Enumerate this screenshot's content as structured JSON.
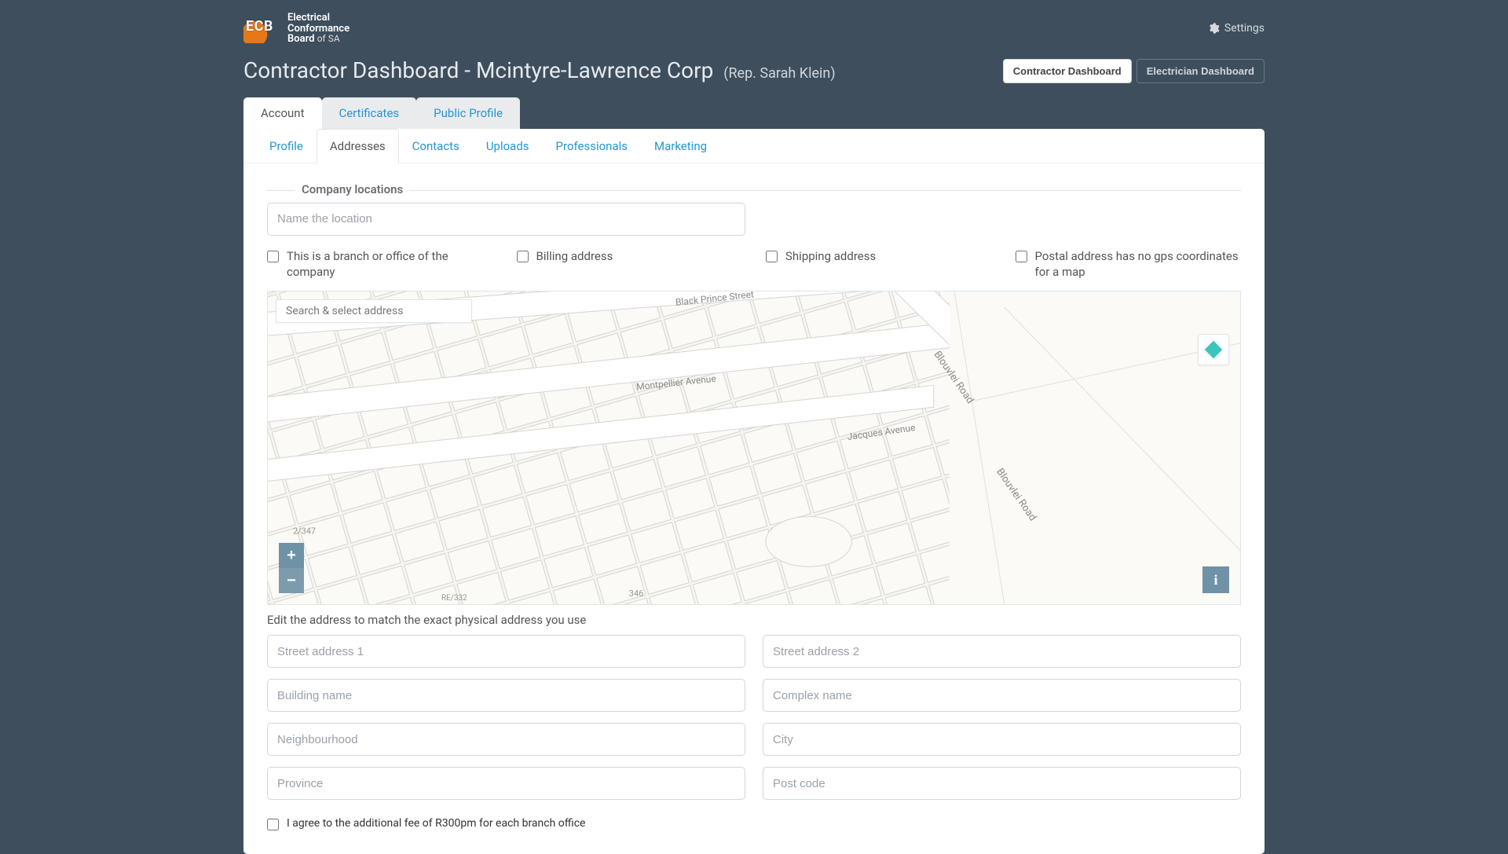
{
  "header": {
    "brand_line1": "Electrical",
    "brand_line2": "Conformance",
    "brand_line3": "Board",
    "brand_suffix": "of SA",
    "settings_label": "Settings",
    "page_title": "Contractor Dashboard - Mcintyre-Lawrence Corp",
    "rep": "(Rep. Sarah Klein)",
    "dash_contractor": "Contractor Dashboard",
    "dash_electrician": "Electrician Dashboard"
  },
  "primary_tabs": {
    "account": "Account",
    "certificates": "Certificates",
    "public_profile": "Public Profile"
  },
  "sub_tabs": {
    "profile": "Profile",
    "addresses": "Addresses",
    "contacts": "Contacts",
    "uploads": "Uploads",
    "professionals": "Professionals",
    "marketing": "Marketing"
  },
  "form": {
    "legend": "Company locations",
    "location_name_ph": "Name the location",
    "cb_branch": "This is a branch or office of the company",
    "cb_billing": "Billing address",
    "cb_shipping": "Shipping address",
    "cb_postal_no_gps": "Postal address has no gps coordinates for a map",
    "map_search_ph": "Search & select address",
    "map_streets": {
      "black_prince": "Black Prince Street",
      "montpellier": "Montpellier Avenue",
      "jacques": "Jacques Avenue",
      "blouvlei_1": "Blouvlei Road",
      "blouvlei_2": "Blouvlei Road"
    },
    "map_parcels": {
      "a": "2/347",
      "b": "346",
      "c": "RE/332"
    },
    "edit_hint": "Edit the address to match the exact physical address you use",
    "street1_ph": "Street address 1",
    "street2_ph": "Street address 2",
    "building_ph": "Building name",
    "complex_ph": "Complex name",
    "neighbourhood_ph": "Neighbourhood",
    "city_ph": "City",
    "province_ph": "Province",
    "postcode_ph": "Post code",
    "agree_fee": "I agree to the additional fee of R300pm for each branch office",
    "zoom_in": "+",
    "zoom_out": "−",
    "info": "i"
  },
  "colors": {
    "link": "#2596d1",
    "bg": "#3e4e5d",
    "accent": "#e67817",
    "teal": "#3cc4bd"
  }
}
